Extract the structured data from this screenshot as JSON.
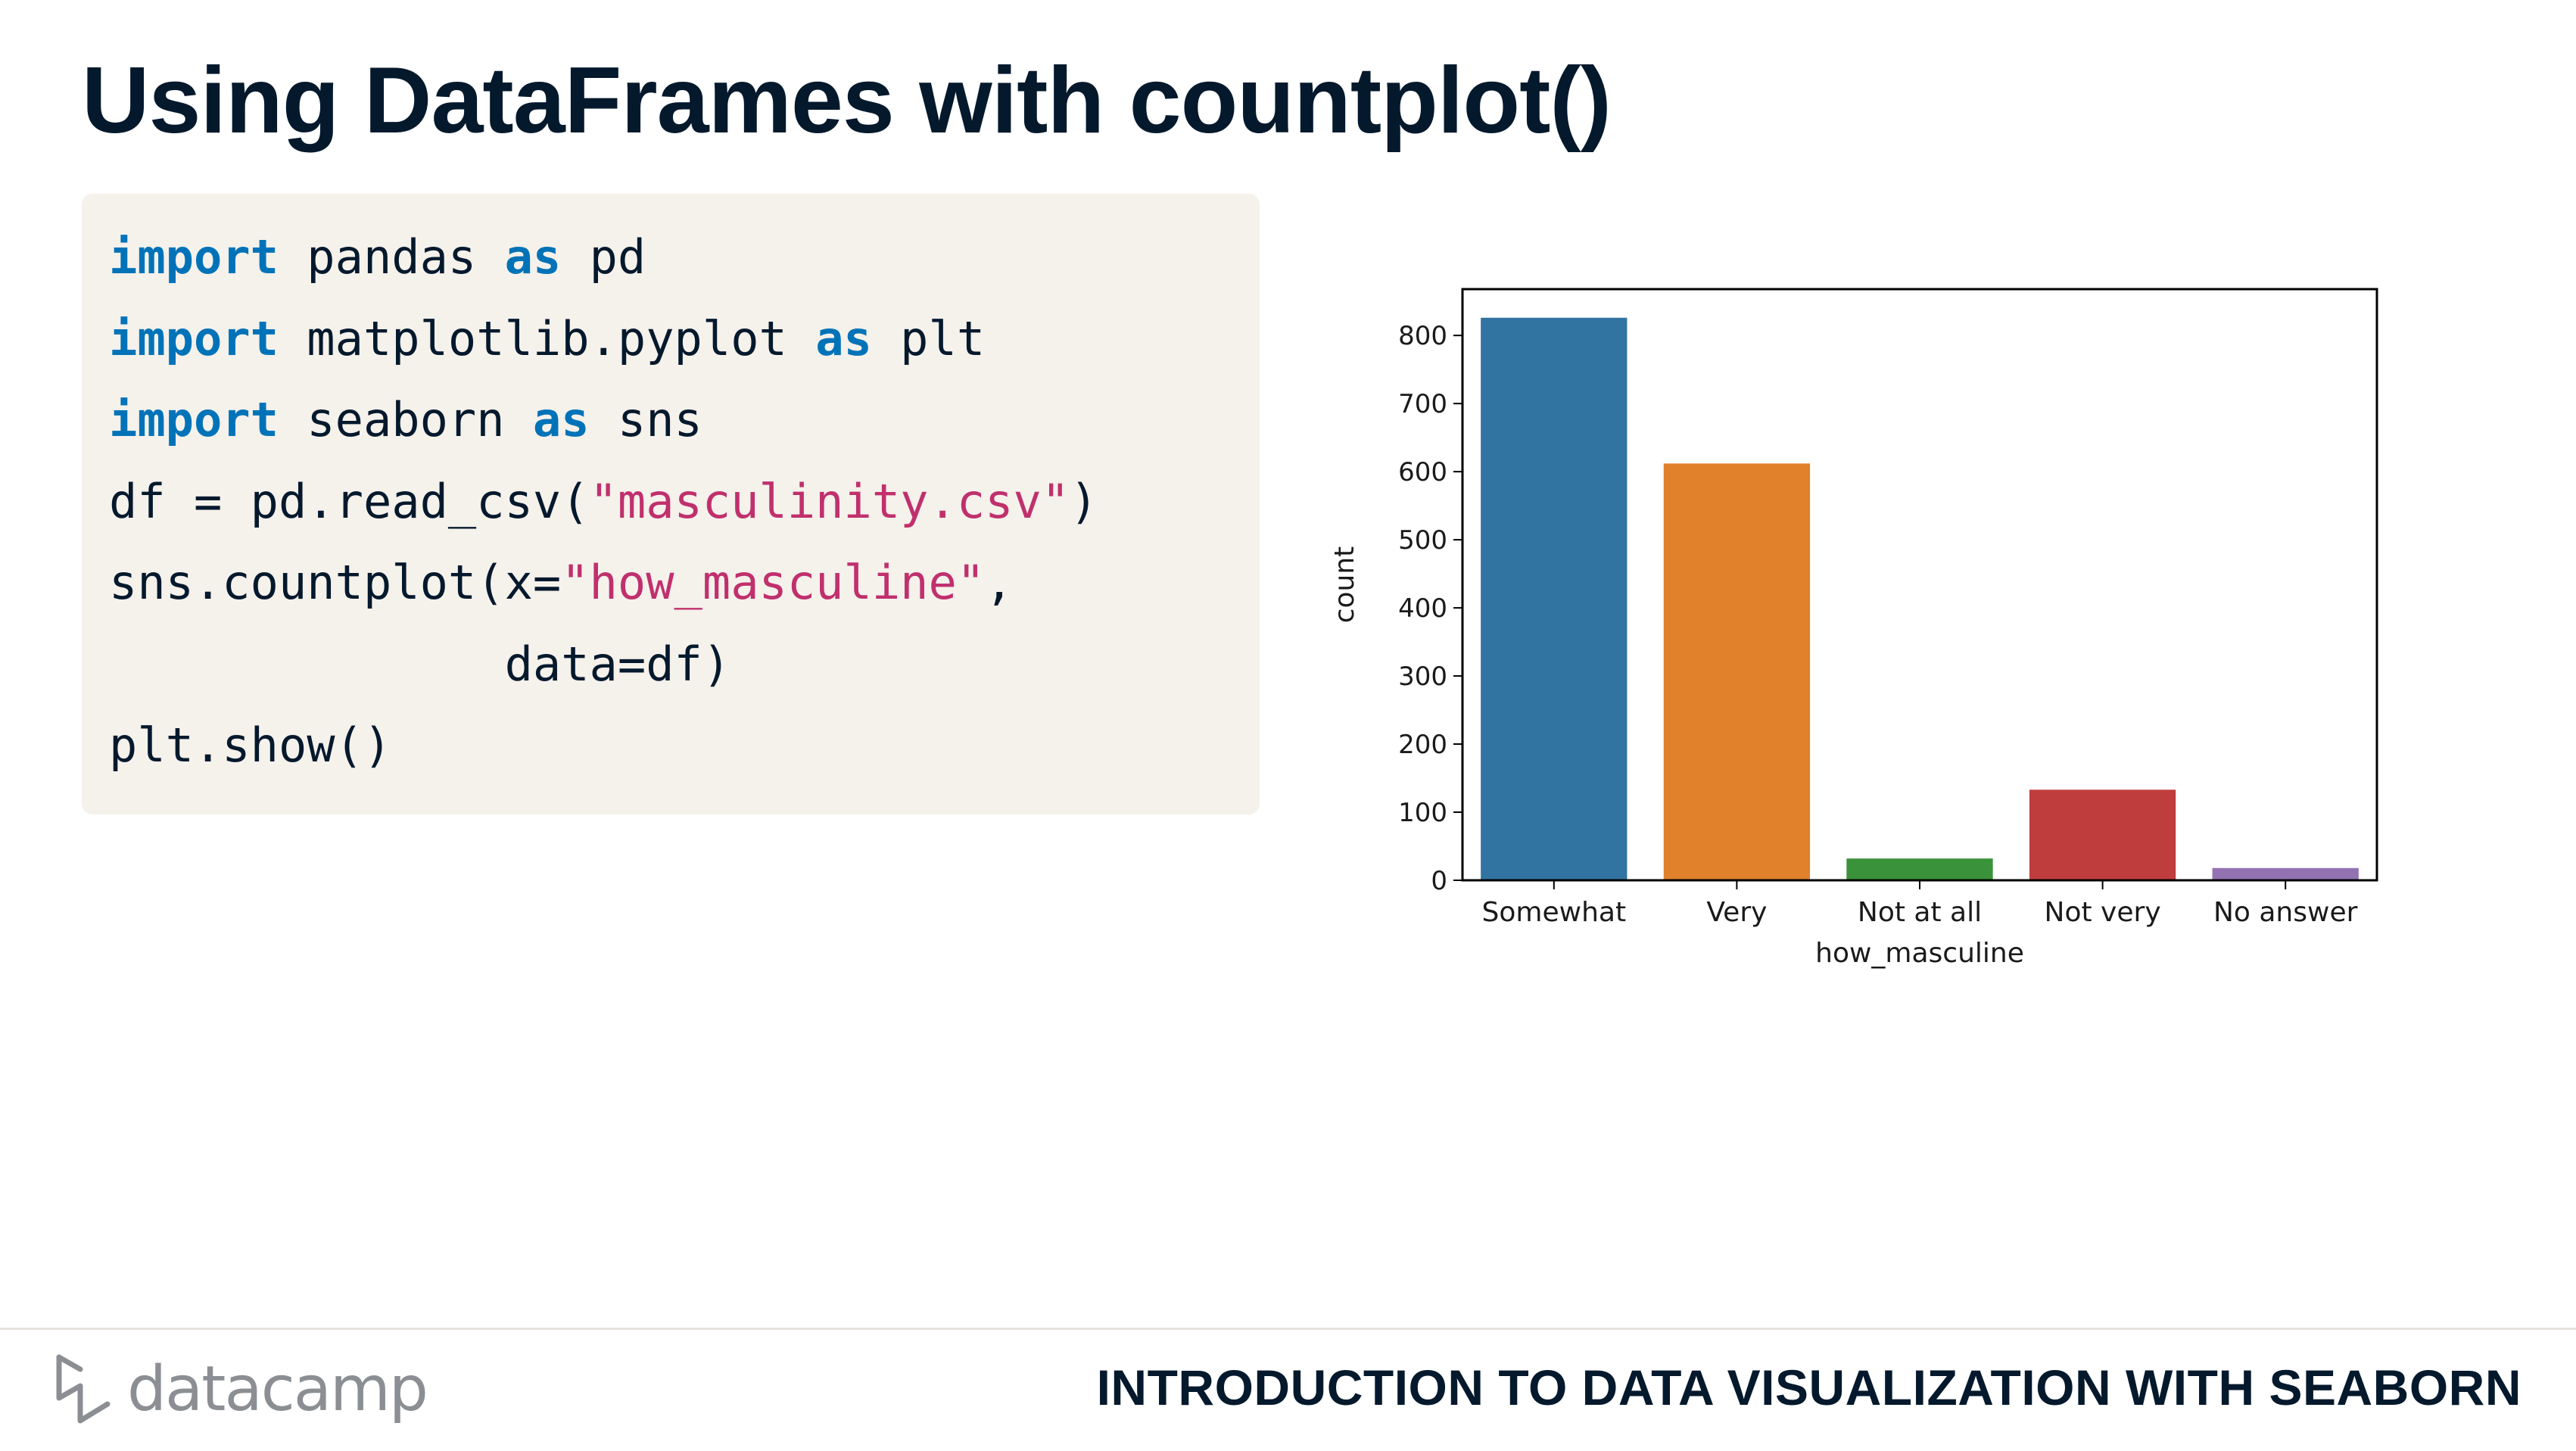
{
  "slide": {
    "title": "Using DataFrames with countplot()",
    "course": "INTRODUCTION TO DATA VISUALIZATION WITH SEABORN",
    "brand": "datacamp",
    "brand_icon": "datacamp-logo-icon"
  },
  "code": {
    "lines": [
      [
        {
          "t": "import",
          "c": "kw"
        },
        {
          "t": " pandas "
        },
        {
          "t": "as",
          "c": "kw"
        },
        {
          "t": " pd"
        }
      ],
      [
        {
          "t": "import",
          "c": "kw"
        },
        {
          "t": " matplotlib.pyplot "
        },
        {
          "t": "as",
          "c": "kw"
        },
        {
          "t": " plt"
        }
      ],
      [
        {
          "t": "import",
          "c": "kw"
        },
        {
          "t": " seaborn "
        },
        {
          "t": "as",
          "c": "kw"
        },
        {
          "t": " sns"
        }
      ],
      [
        {
          "t": "df = pd.read_csv("
        },
        {
          "t": "\"masculinity.csv\"",
          "c": "str"
        },
        {
          "t": ")"
        }
      ],
      [
        {
          "t": "sns.countplot(x="
        },
        {
          "t": "\"how_masculine\"",
          "c": "str"
        },
        {
          "t": ","
        }
      ],
      [
        {
          "t": "              data=df)"
        }
      ],
      [
        {
          "t": "plt.show()"
        }
      ]
    ]
  },
  "chart_data": {
    "type": "bar",
    "categories": [
      "Somewhat",
      "Very",
      "Not at all",
      "Not very",
      "No answer"
    ],
    "values": [
      826,
      612,
      32,
      133,
      18
    ],
    "colors": [
      "#3274a1",
      "#e1812c",
      "#3a923a",
      "#c03d3e",
      "#9372b2"
    ],
    "xlabel": "how_masculine",
    "ylabel": "count",
    "ylim": [
      0,
      868
    ],
    "yticks": [
      0,
      100,
      200,
      300,
      400,
      500,
      600,
      700,
      800
    ],
    "grid": false
  }
}
